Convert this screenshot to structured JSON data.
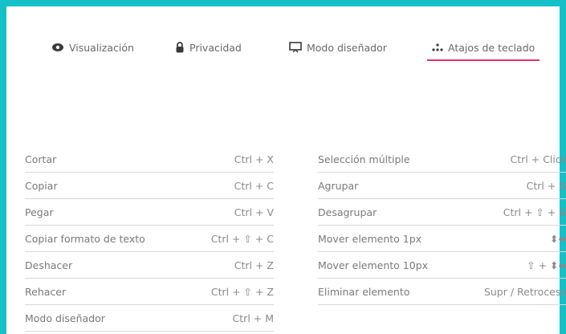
{
  "tabs": [
    {
      "label": "Visualización",
      "icon": "eye-icon"
    },
    {
      "label": "Privacidad",
      "icon": "lock-icon"
    },
    {
      "label": "Modo diseñador",
      "icon": "monitor-icon"
    },
    {
      "label": "Atajos de teclado",
      "icon": "dots-icon",
      "active": true
    }
  ],
  "colors": {
    "frame": "#14c1c8",
    "active_underline": "#e2336b"
  },
  "shortcuts_left": [
    {
      "label": "Cortar",
      "keys": "Ctrl + X"
    },
    {
      "label": "Copiar",
      "keys": "Ctrl + C"
    },
    {
      "label": "Pegar",
      "keys": "Ctrl + V"
    },
    {
      "label": "Copiar formato de texto",
      "keys": "Ctrl + ⇧ + C"
    },
    {
      "label": "Deshacer",
      "keys": "Ctrl + Z"
    },
    {
      "label": "Rehacer",
      "keys": "Ctrl + ⇧ + Z"
    },
    {
      "label": "Modo diseñador",
      "keys": "Ctrl + M"
    }
  ],
  "shortcuts_right": [
    {
      "label": "Selección múltiple",
      "keys": "Ctrl + Click"
    },
    {
      "label": "Agrupar",
      "keys": "Ctrl + G"
    },
    {
      "label": "Desagrupar",
      "keys": "Ctrl + ⇧ + G"
    },
    {
      "label": "Mover elemento 1px",
      "keys": "⬍⬌"
    },
    {
      "label": "Mover elemento 10px",
      "keys": "⇧ + ⬍⬌"
    },
    {
      "label": "Eliminar elemento",
      "keys": "Supr / Retroceso"
    }
  ]
}
